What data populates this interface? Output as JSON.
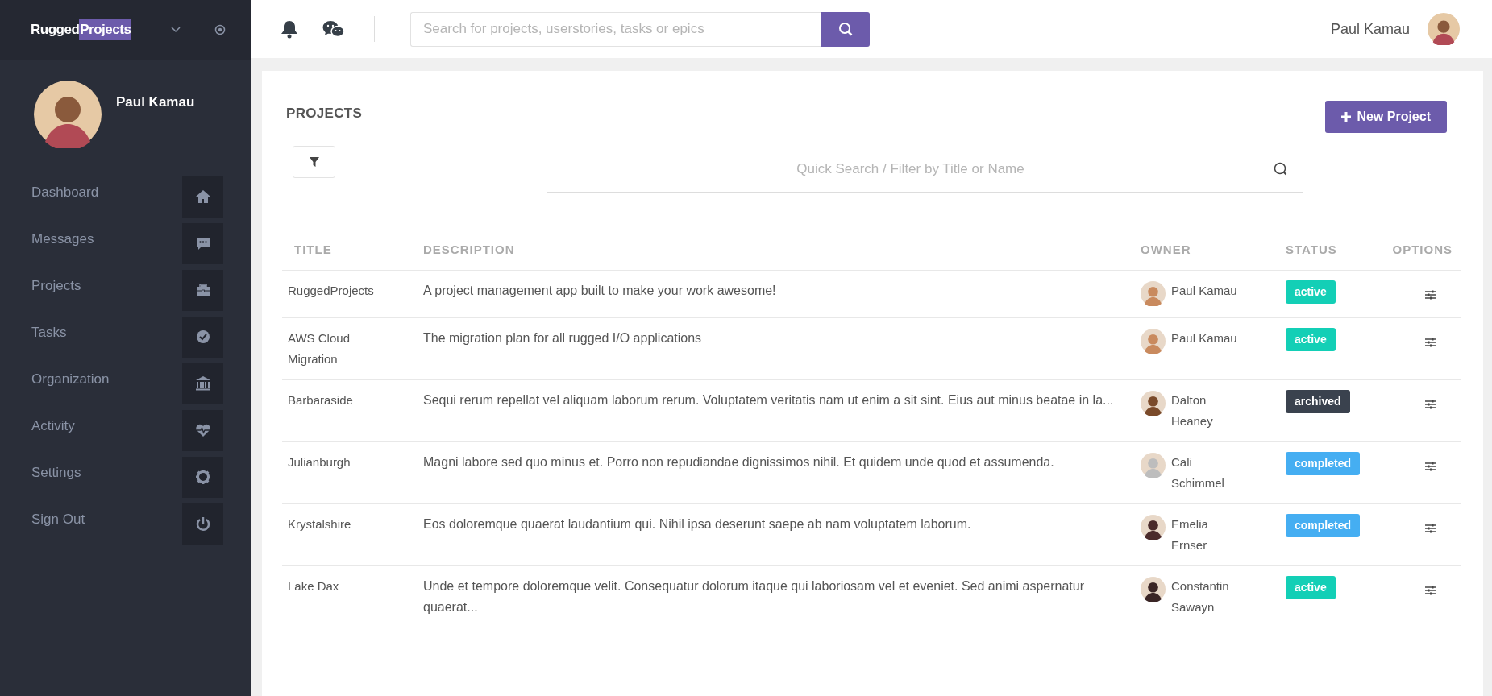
{
  "brand": {
    "part_1": "Rugged",
    "part_2": "Projects"
  },
  "profile": {
    "name": "Paul Kamau"
  },
  "sidebar": {
    "items": [
      {
        "label": "Dashboard",
        "kind": "home"
      },
      {
        "label": "Messages",
        "kind": "message"
      },
      {
        "label": "Projects",
        "kind": "briefcase"
      },
      {
        "label": "Tasks",
        "kind": "check"
      },
      {
        "label": "Organization",
        "kind": "bank"
      },
      {
        "label": "Activity",
        "kind": "heartbeat"
      },
      {
        "label": "Settings",
        "kind": "gear"
      },
      {
        "label": "Sign Out",
        "kind": "power"
      }
    ]
  },
  "topbar": {
    "search": {
      "placeholder": "Search for projects, userstories, tasks or epics"
    },
    "user_name": "Paul Kamau"
  },
  "page": {
    "title": "PROJECTS",
    "new_button": "New Project",
    "filter_search": {
      "placeholder": "Quick Search / Filter by Title or Name"
    }
  },
  "table": {
    "columns": [
      "TITLE",
      "DESCRIPTION",
      "OWNER",
      "STATUS",
      "OPTIONS"
    ],
    "rows": [
      {
        "title": "RuggedProjects",
        "description": "A project management app built to make your work awesome!",
        "owner": "Paul Kamau",
        "status": {
          "label": "active",
          "color": "#13cfb6"
        }
      },
      {
        "title": "AWS Cloud Migration",
        "description": "The migration plan for all rugged I/O applications",
        "owner": "Paul Kamau",
        "status": {
          "label": "active",
          "color": "#13cfb6"
        }
      },
      {
        "title": "Barbaraside",
        "description": "Sequi rerum repellat vel aliquam laborum rerum. Voluptatem veritatis nam ut enim a sit sint. Eius aut minus beatae in la...",
        "owner": "Dalton Heaney",
        "status": {
          "label": "archived",
          "color": "#3a424e"
        }
      },
      {
        "title": "Julianburgh",
        "description": "Magni labore sed quo minus et. Porro non repudiandae dignissimos nihil. Et quidem unde quod et assumenda.",
        "owner": "Cali Schimmel",
        "status": {
          "label": "completed",
          "color": "#45aef2"
        }
      },
      {
        "title": "Krystalshire",
        "description": "Eos doloremque quaerat laudantium qui. Nihil ipsa deserunt saepe ab nam voluptatem laborum.",
        "owner": "Emelia Ernser",
        "status": {
          "label": "completed",
          "color": "#45aef2"
        }
      },
      {
        "title": "Lake Dax",
        "description": "Unde et tempore doloremque velit. Consequatur dolorum itaque qui laboriosam vel et eveniet. Sed animi aspernatur quaerat...",
        "owner": "Constantin Sawayn",
        "status": {
          "label": "active",
          "color": "#13cfb6"
        }
      }
    ]
  }
}
